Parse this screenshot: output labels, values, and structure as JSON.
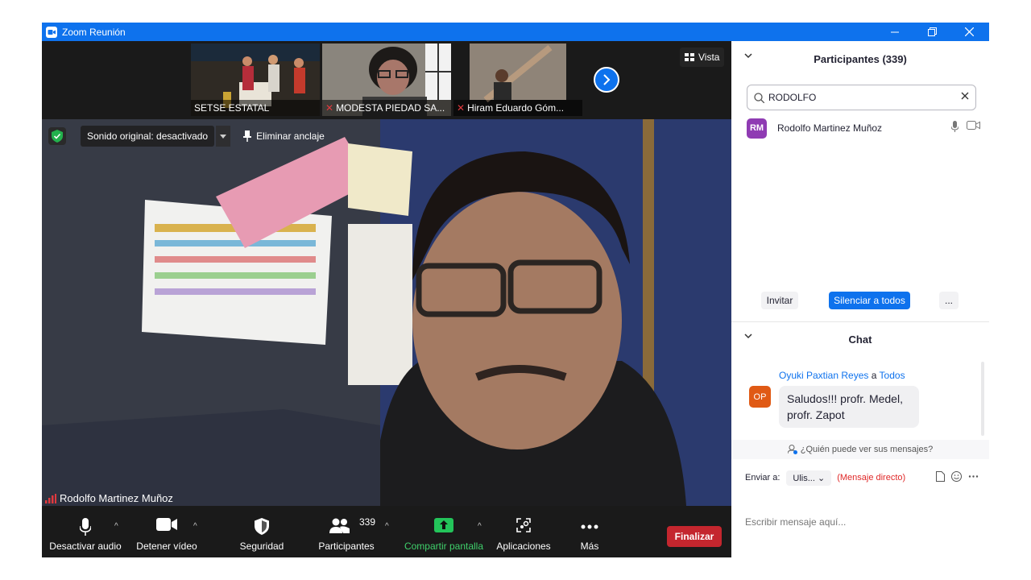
{
  "window": {
    "title": "Zoom Reunión",
    "accent": "#0e72ed"
  },
  "thumbnails": [
    {
      "label": "SETSE ESTATAL",
      "muted": false
    },
    {
      "label": "MODESTA PIEDAD SA...",
      "muted": true
    },
    {
      "label": "Hiram Eduardo Góm...",
      "muted": true
    }
  ],
  "view_button": {
    "label": "Vista"
  },
  "main_video": {
    "speaker": "Rodolfo Martinez Muñoz",
    "original_sound": "Sonido original: desactivado",
    "unpin": "Eliminar anclaje"
  },
  "toolbar": {
    "mute": "Desactivar audio",
    "video": "Detener vídeo",
    "security": "Seguridad",
    "participants": "Participantes",
    "participants_count": "339",
    "share": "Compartir pantalla",
    "apps": "Aplicaciones",
    "more": "Más",
    "end": "Finalizar"
  },
  "participants_panel": {
    "title": "Participantes (339)",
    "search_value": "RODOLFO",
    "results": [
      {
        "initials": "RM",
        "name": "Rodolfo Martinez Muñoz"
      }
    ],
    "invite": "Invitar",
    "mute_all": "Silenciar a todos",
    "more": "..."
  },
  "chat_panel": {
    "title": "Chat",
    "messages": [
      {
        "initials": "OP",
        "sender": "Oyuki Paxtian Reyes",
        "to_word": "a",
        "recipient": "Todos",
        "line1": "Saludos!!! profr. Medel,",
        "line2": "profr. Zapot"
      }
    ],
    "who_can_see": "¿Quién puede ver sus mensajes?",
    "send_to_label": "Enviar a:",
    "send_to_value": "Ulis...",
    "direct_tag": "(Mensaje directo)",
    "input_placeholder": "Escribir mensaje aquí..."
  }
}
